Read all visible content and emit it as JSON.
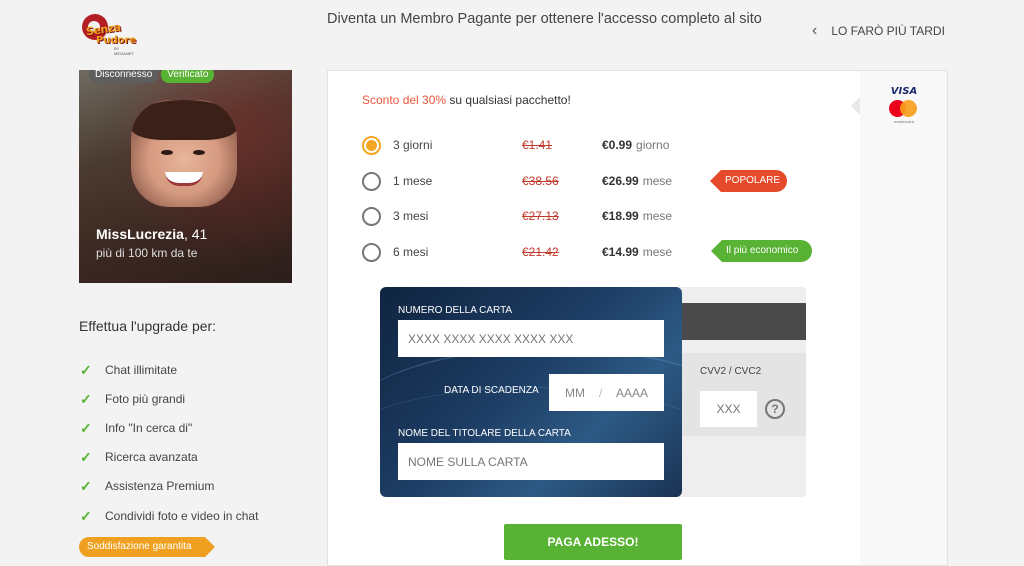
{
  "logo": {
    "line1": "Senza",
    "line2": "Pudore",
    "tm": "BY MEGANET"
  },
  "header": {
    "message": "Diventa un Membro Pagante per ottenere l'accesso completo al sito",
    "later_label": "LO FARÒ PIÙ TARDI"
  },
  "profile": {
    "badge_disconnect": "Disconnesso",
    "badge_verified": "Verificato",
    "name": "MissLucrezia",
    "age": ", 41",
    "distance": "più di 100 km da te"
  },
  "upgrade": {
    "title": "Effettua l'upgrade per:",
    "features": [
      "Chat illimitate",
      "Foto più grandi",
      "Info \"In cerca di\"",
      "Ricerca avanzata",
      "Assistenza Premium",
      "Condividi foto e video in chat"
    ],
    "guarantee": "Soddisfazione garantita"
  },
  "offer": {
    "discount_highlight": "Sconto del 30%",
    "discount_rest": " su qualsiasi pacchetto!"
  },
  "plans": [
    {
      "duration": "3 giorni",
      "old_price": "€1.41",
      "price": "€0.99",
      "unit": "giorno",
      "selected": true
    },
    {
      "duration": "1 mese",
      "old_price": "€38.56",
      "price": "€26.99",
      "unit": "mese",
      "selected": false,
      "tag": "POPOLARE"
    },
    {
      "duration": "3 mesi",
      "old_price": "€27.13",
      "price": "€18.99",
      "unit": "mese",
      "selected": false
    },
    {
      "duration": "6 mesi",
      "old_price": "€21.42",
      "price": "€14.99",
      "unit": "mese",
      "selected": false,
      "tag": "Il più economico"
    }
  ],
  "card_form": {
    "number_label": "NUMERO DELLA CARTA",
    "number_placeholder": "XXXX XXXX XXXX XXXX XXX",
    "expiry_label": "DATA DI SCADENZA",
    "expiry_month": "MM",
    "expiry_sep": "/",
    "expiry_year": "AAAA",
    "holder_label": "NOME DEL TITOLARE DELLA CARTA",
    "holder_placeholder": "NOME SULLA CARTA",
    "cvv_label": "CVV2 / CVC2",
    "cvv_placeholder": "XXX",
    "cvv_help": "?"
  },
  "payment_logos": {
    "visa": "VISA",
    "mastercard": "mastercard"
  },
  "pay_button": "PAGA ADESSO!",
  "colors": {
    "accent_green": "#58b233",
    "accent_orange": "#f5a623",
    "tag_red": "#e54a2b",
    "discount": "#e8573a"
  }
}
